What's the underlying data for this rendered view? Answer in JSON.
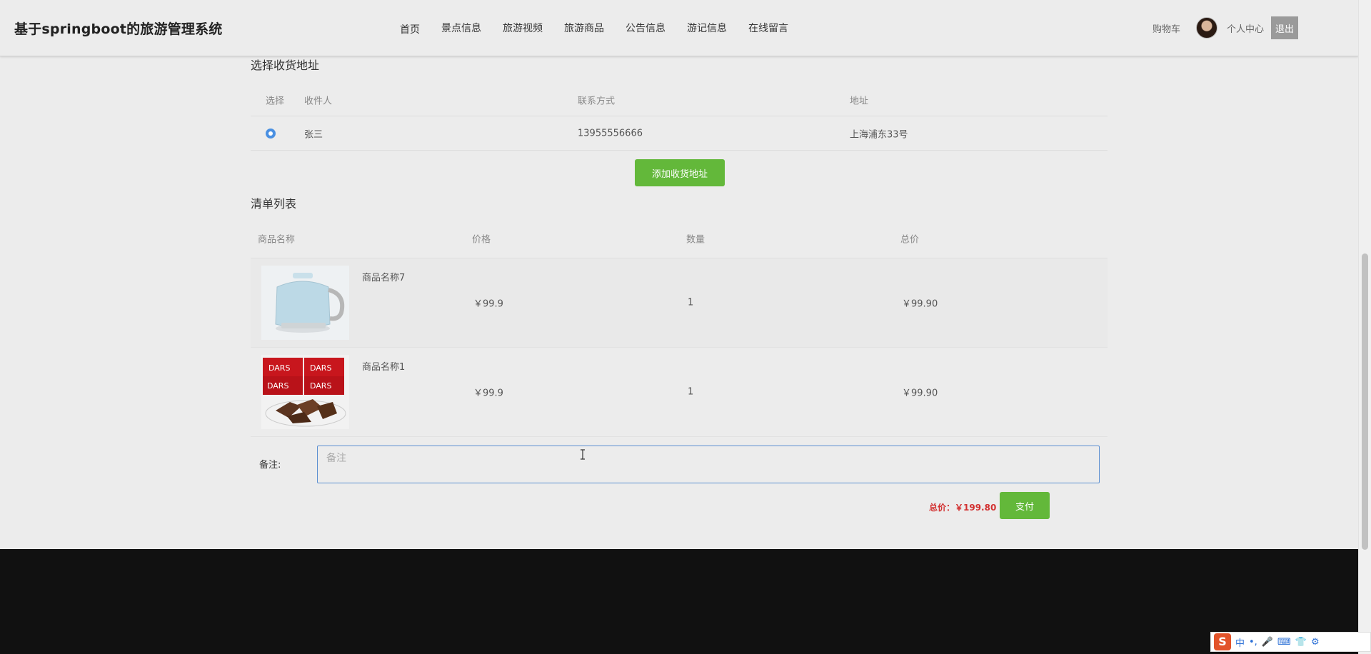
{
  "header": {
    "site_title": "基于springboot的旅游管理系统",
    "nav": [
      "首页",
      "景点信息",
      "旅游视频",
      "旅游商品",
      "公告信息",
      "游记信息",
      "在线留言"
    ],
    "cart": "购物车",
    "profile": "个人中心",
    "logout": "退出"
  },
  "address_section": {
    "title": "选择收货地址",
    "columns": [
      "选择",
      "收件人",
      "联系方式",
      "地址"
    ],
    "rows": [
      {
        "selected": true,
        "recipient": "张三",
        "phone": "13955556666",
        "address": "上海浦东33号"
      }
    ],
    "add_button": "添加收货地址"
  },
  "order_section": {
    "title": "清单列表",
    "columns": [
      "商品名称",
      "价格",
      "数量",
      "总价"
    ],
    "rows": [
      {
        "name": "商品名称7",
        "price": "￥99.9",
        "qty": "1",
        "total": "￥99.90",
        "image": "kettle-image"
      },
      {
        "name": "商品名称1",
        "price": "￥99.9",
        "qty": "1",
        "total": "￥99.90",
        "image": "chocolate-image"
      }
    ]
  },
  "note": {
    "label": "备注:",
    "placeholder": "备注",
    "value": ""
  },
  "summary": {
    "total_label": "总价：￥199.80",
    "pay_button": "支付"
  },
  "tray": {
    "ime_mode": "中",
    "punct": "•,"
  },
  "colors": {
    "accent_green": "#63b83a",
    "radio_blue": "#4a90e2",
    "total_red": "#d23030",
    "footer": "#111111"
  }
}
